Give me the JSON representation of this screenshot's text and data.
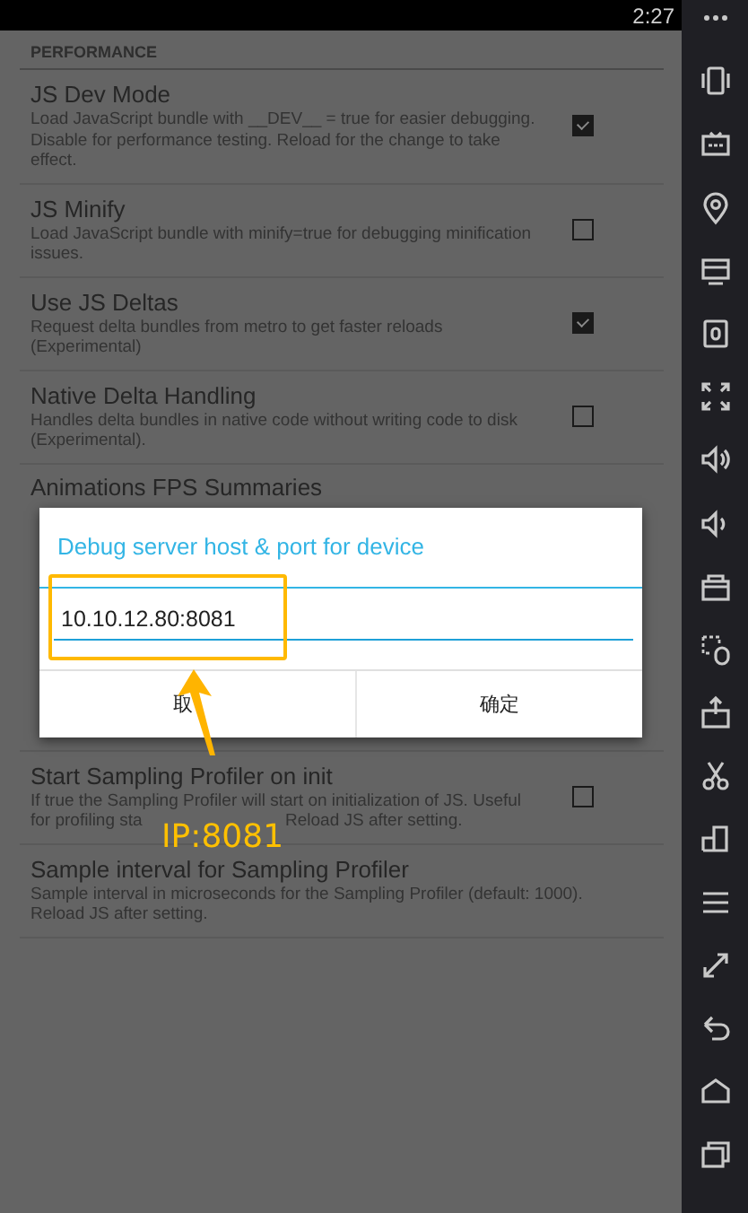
{
  "status_bar": {
    "time": "2:27"
  },
  "section": {
    "title": "PERFORMANCE"
  },
  "settings": [
    {
      "kind": "check",
      "title": "JS Dev Mode",
      "description": "Load JavaScript bundle with __DEV__ = true for easier debugging. Disable for performance testing. Reload for the change to take effect.",
      "checked": true
    },
    {
      "kind": "check",
      "title": "JS Minify",
      "description": "Load JavaScript bundle with minify=true for debugging minification issues.",
      "checked": false
    },
    {
      "kind": "check",
      "title": "Use JS Deltas",
      "description": "Request delta bundles from metro to get faster reloads (Experimental)",
      "checked": true
    },
    {
      "kind": "check",
      "title": "Native Delta Handling",
      "description": "Handles delta bundles in native code without writing code to disk (Experimental).",
      "checked": false
    },
    {
      "kind": "covered",
      "title": "Animations FPS Summaries"
    },
    {
      "kind": "interrupted",
      "title": "Start Sampling Profiler on init",
      "description_lines": [
        "If true the Sampling Profiler will start on initialization of JS. Useful",
        "for profiling sta"
      ],
      "description_tail": "Reload JS after setting.",
      "checked": false
    },
    {
      "kind": "text",
      "title": "Sample interval for Sampling Profiler",
      "description": "Sample interval in microseconds for the Sampling Profiler (default: 1000). Reload JS after setting."
    }
  ],
  "dialog": {
    "title": "Debug server host & port for device",
    "field": {
      "value": "10.10.12.80:8081"
    },
    "buttons": [
      {
        "label": "取"
      },
      {
        "label": "确定"
      }
    ]
  },
  "annotation": {
    "label": "IP:8081"
  }
}
